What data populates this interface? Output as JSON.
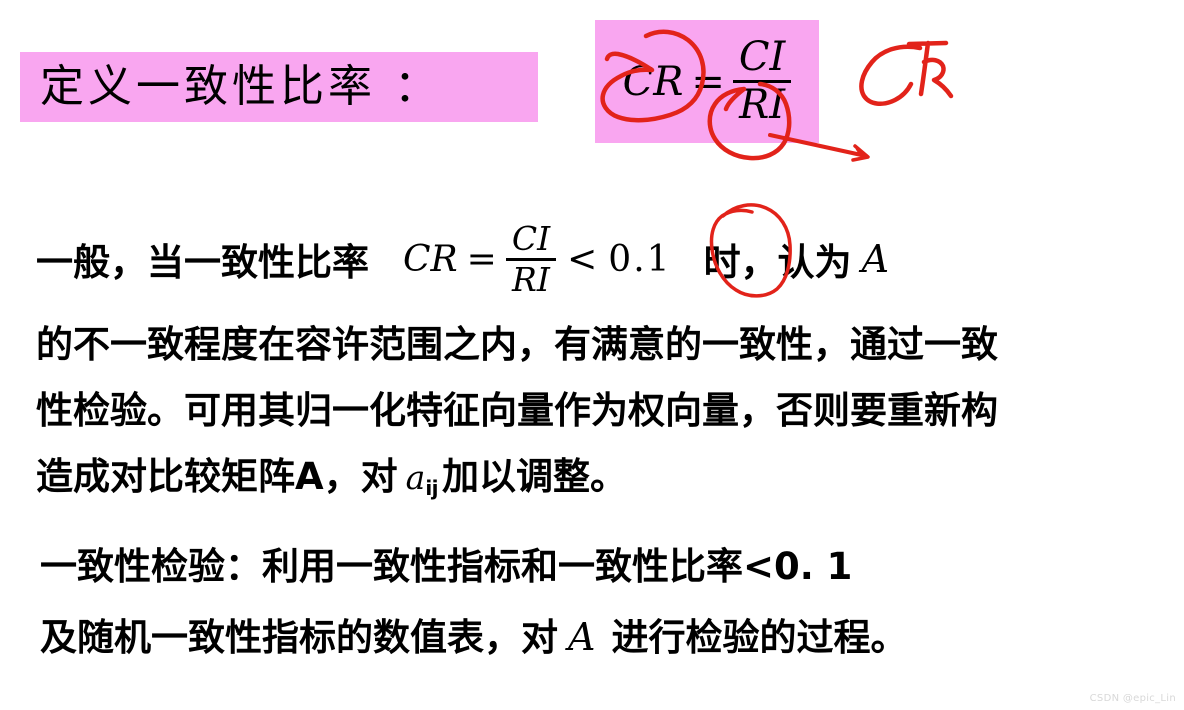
{
  "slide": {
    "background_color": "#ffffff",
    "highlight_color": "#f9a6f0",
    "ink_color": "#e2231a",
    "text_color": "#000000"
  },
  "title": {
    "text": "定义一致性比率 ："
  },
  "title_formula": {
    "lhs": "CR",
    "operator": "=",
    "numerator": "CI",
    "denominator": "RI"
  },
  "general_line": {
    "prefix": "一般，当一致性比率",
    "lhs": "CR",
    "operator": "=",
    "numerator": "CI",
    "denominator": "RI",
    "comparison": "<",
    "threshold": "0.1",
    "suffix": "时，认为",
    "matrix_symbol": "A"
  },
  "paragraph": {
    "line1": "的不一致程度在容许范围之内，有满意的一致性，通过一致",
    "line2": "性检验。可用其归一化特征向量作为权向量，否则要重新构",
    "line3_before": "造成对比较矩阵A，对",
    "line3_symbol": "a",
    "line3_subscript": "ij",
    "line3_after": "加以调整。"
  },
  "conclusion": {
    "line1": "一致性检验：利用一致性指标和一致性比率<0. 1",
    "line2_before": "及随机一致性指标的数值表，对",
    "line2_symbol": "A",
    "line2_after": "进行检验的过程。"
  },
  "annotations": {
    "circle_cr_label": "circle around CR",
    "circle_ri_label": "circle around RI",
    "arrow_label": "arrow pointing down-right from RI",
    "handwritten_cr": "CR",
    "circle_threshold_label": "circle around 0.1"
  },
  "watermark": {
    "text": "CSDN @epic_Lin"
  }
}
